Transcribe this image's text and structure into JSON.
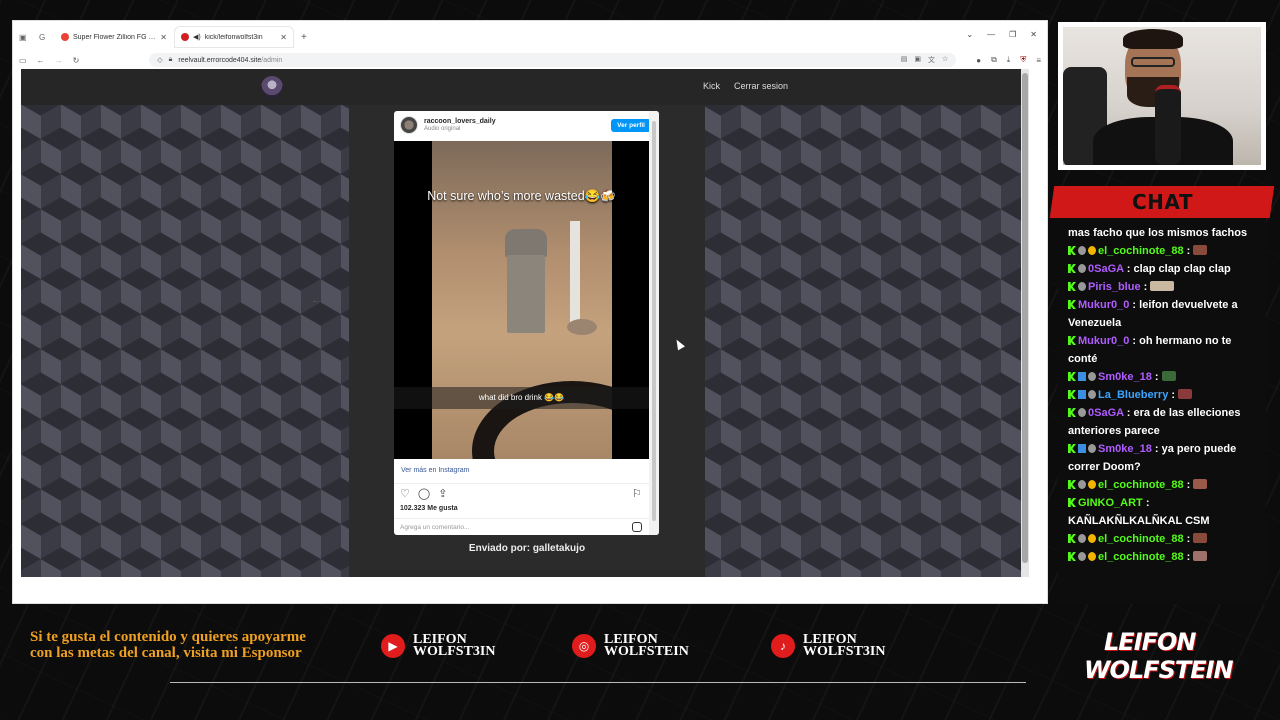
{
  "browser": {
    "tabs": [
      {
        "title": "Super Flower Zillion FG (SF-125...",
        "fav_color": "#ea4335"
      },
      {
        "title": "kick/leifonwolfst3in",
        "fav_color": "#d02020"
      }
    ],
    "new_tab": "+",
    "url_host": "reelvault.errorcode404.site",
    "url_path": "/admin",
    "url_prefix": "reelvault."
  },
  "site": {
    "nav": [
      {
        "label": "Kick"
      },
      {
        "label": "Cerrar sesion"
      }
    ],
    "prev_arrow": "←",
    "next_arrow": "→",
    "sent_by": "Enviado por: galletakujo"
  },
  "instagram": {
    "username": "raccoon_lovers_daily",
    "audio": "Audio original",
    "follow_button": "Ver perfil",
    "caption_top": "Not sure who’s more wasted😂🍻",
    "caption_bottom": "what did bro drink 😂😂",
    "view_more": "Ver más en Instagram",
    "likes": "102.323 Me gusta",
    "comment_placeholder": "Agrega un comentario..."
  },
  "chat": {
    "title": "CHAT",
    "messages": [
      {
        "badges": [],
        "user": "",
        "user_class": "u-white",
        "sep": "",
        "text": "mas facho que los mismos fachos"
      },
      {
        "badges": [
          "b-kick",
          "b-gray",
          "b-gold"
        ],
        "user": "el_cochinote_88",
        "user_class": "u-green",
        "sep": " : ",
        "text": "",
        "emote": "#8a4a3a"
      },
      {
        "badges": [
          "b-kick",
          "b-gray"
        ],
        "user": "0SaGA",
        "user_class": "u-purple",
        "sep": " : ",
        "text": "clap clap clap clap"
      },
      {
        "badges": [
          "b-kick",
          "b-gray"
        ],
        "user": "Piris_blue",
        "user_class": "u-purple",
        "sep": " : ",
        "text": "",
        "emote": "#c9b9a0",
        "emote_wide": true
      },
      {
        "badges": [
          "b-kick"
        ],
        "user": "Mukur0_0",
        "user_class": "u-purple",
        "sep": " : ",
        "text": "leifon devuelvete a Venezuela"
      },
      {
        "badges": [
          "b-kick"
        ],
        "user": "Mukur0_0",
        "user_class": "u-purple",
        "sep": " : ",
        "text": "oh hermano no te conté"
      },
      {
        "badges": [
          "b-kick",
          "b-blue",
          "b-gray"
        ],
        "user": "Sm0ke_18",
        "user_class": "u-purple",
        "sep": " : ",
        "text": "",
        "emote": "#3a6a3a"
      },
      {
        "badges": [
          "b-kick",
          "b-blue",
          "b-gray"
        ],
        "user": "La_Blueberry",
        "user_class": "u-blue",
        "sep": " : ",
        "text": "",
        "emote": "#8a3a3a"
      },
      {
        "badges": [
          "b-kick",
          "b-gray"
        ],
        "user": "0SaGA",
        "user_class": "u-purple",
        "sep": " : ",
        "text": "era de las elleciones anteriores parece"
      },
      {
        "badges": [
          "b-kick",
          "b-blue",
          "b-gray"
        ],
        "user": "Sm0ke_18",
        "user_class": "u-purple",
        "sep": " : ",
        "text": "ya pero puede correr Doom?"
      },
      {
        "badges": [
          "b-kick",
          "b-gray",
          "b-gold"
        ],
        "user": "el_cochinote_88",
        "user_class": "u-green",
        "sep": " : ",
        "text": "",
        "emote": "#9a5a4a"
      },
      {
        "badges": [
          "b-kick"
        ],
        "user": "GINKO_ART",
        "user_class": "u-green",
        "sep": " : ",
        "text": "KAÑLAKÑLKALÑKAL CSM"
      },
      {
        "badges": [
          "b-kick",
          "b-gray",
          "b-gold"
        ],
        "user": "el_cochinote_88",
        "user_class": "u-green",
        "sep": " : ",
        "text": "",
        "emote": "#8a4a3a"
      },
      {
        "badges": [
          "b-kick",
          "b-gray",
          "b-gold"
        ],
        "user": "el_cochinote_88",
        "user_class": "u-green",
        "sep": " : ",
        "text": "",
        "emote": "#a0706a"
      }
    ]
  },
  "footer": {
    "support_text": "Si te gusta el contenido y quieres apoyarme con las metas del canal, visita mi Esponsor",
    "socials": [
      {
        "icon": "youtube-icon",
        "glyph": "▶",
        "line1": "LEIFON",
        "line2": "WOLFST3IN"
      },
      {
        "icon": "instagram-icon",
        "glyph": "◎",
        "line1": "LEIFON",
        "line2": "WOLFSTEIN"
      },
      {
        "icon": "tiktok-icon",
        "glyph": "♪",
        "line1": "LEIFON",
        "line2": "WOLFST3IN"
      }
    ],
    "brand_line1": "LEIFON",
    "brand_line2": "WOLFSTEIN"
  },
  "colors": {
    "accent_red": "#d01818",
    "kick_green": "#53fc18",
    "footer_gold": "#f0a020"
  }
}
